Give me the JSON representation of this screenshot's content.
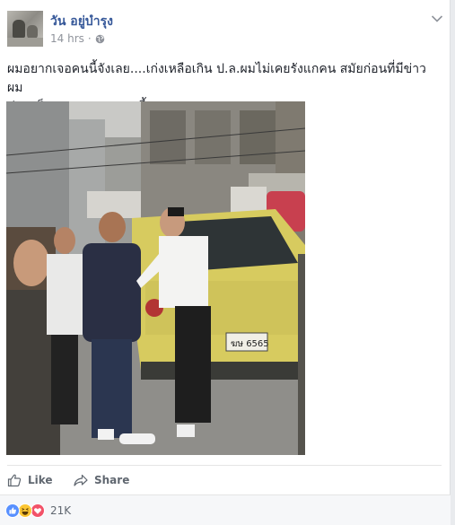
{
  "post": {
    "author": "วัน อยู่บำรุง",
    "time": "14 hrs",
    "separator": "·",
    "privacy_icon": "globe-icon",
    "text_line1": "ผมอยากเจอคนนี้จังเลย....เก่งเหลือเกิน ป.ล.ผมไม่เคยรังแกคน สมัยก่อนที่มีข่าวผม",
    "text_line2": "บ่อยๆก็เพราะเจอคนแบบนี้"
  },
  "photo": {
    "plate": "ฆษ 6565",
    "description_icon": "street-scene-photo"
  },
  "actions": {
    "like_label": "Like",
    "share_label": "Share"
  },
  "reactions": {
    "types": [
      "like",
      "haha",
      "love"
    ],
    "count": "21K"
  },
  "colors": {
    "author": "#365899",
    "meta": "#90949c",
    "action": "#606770",
    "like_blue": "#5890ff",
    "love_red": "#f25268",
    "haha_yellow": "#fcc633"
  }
}
